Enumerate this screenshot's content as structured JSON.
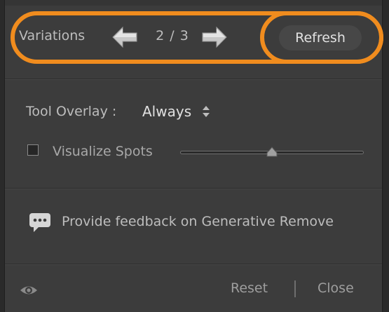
{
  "variations": {
    "label": "Variations",
    "current": 2,
    "total": 3,
    "count_text": "2 / 3",
    "prev_icon": "arrow-left-icon",
    "next_icon": "arrow-right-icon",
    "refresh_label": "Refresh"
  },
  "tool_overlay": {
    "label": "Tool Overlay :",
    "value": "Always"
  },
  "visualize_spots": {
    "label": "Visualize Spots",
    "checked": false,
    "slider_fraction": 0.5
  },
  "feedback": {
    "icon": "speech-bubble-icon",
    "link_text": "Provide feedback on Generative Remove"
  },
  "footer": {
    "toggle_icon": "eye-icon",
    "reset_label": "Reset",
    "close_label": "Close"
  },
  "colors": {
    "highlight": "#f08c1e",
    "panel_bg": "#3c3c3c",
    "button_bg": "#474747"
  }
}
